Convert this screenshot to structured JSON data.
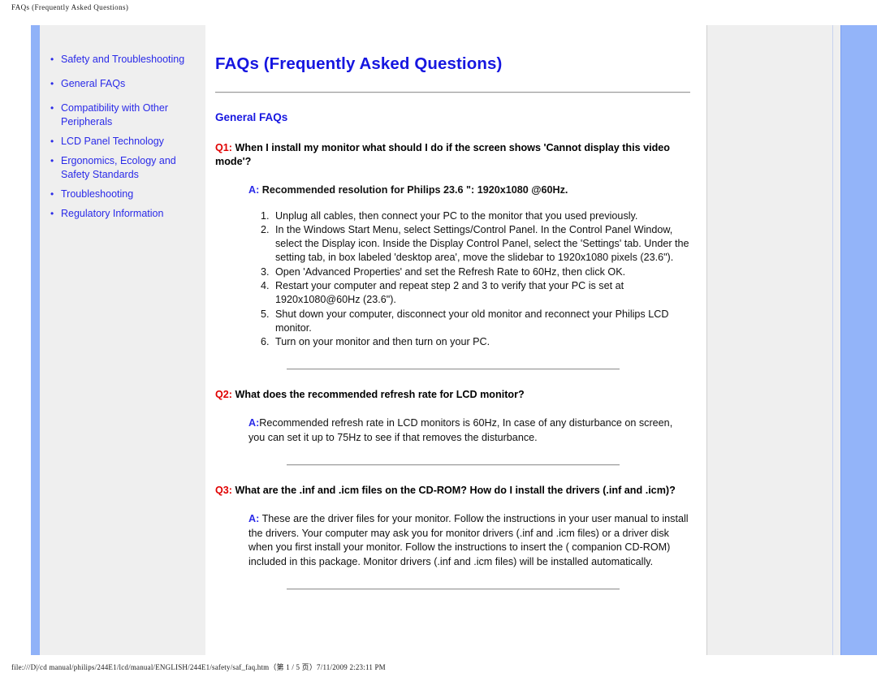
{
  "print_header": "FAQs (Frequently Asked Questions)",
  "print_footer": "file:///D|/cd manual/philips/244E1/lcd/manual/ENGLISH/244E1/safety/saf_faq.htm（第 1 / 5 页）7/11/2009 2:23:11 PM",
  "colors": {
    "link_blue": "#2a2ae8",
    "heading_blue": "#1616e0",
    "question_red": "#e00000",
    "answer_blue": "#2a2ae8",
    "accent_bar": "#90b2f8",
    "panel_gray": "#efefef"
  },
  "sidebar": {
    "items": [
      {
        "label": "Safety and Troubleshooting"
      },
      {
        "label": "General FAQs"
      },
      {
        "label": "Compatibility with Other Peripherals"
      },
      {
        "label": "LCD Panel Technology"
      },
      {
        "label": "Ergonomics, Ecology and Safety Standards"
      },
      {
        "label": "Troubleshooting"
      },
      {
        "label": "Regulatory Information"
      }
    ]
  },
  "main": {
    "title": "FAQs (Frequently Asked Questions)",
    "section_title": "General FAQs",
    "faqs": [
      {
        "q_marker": "Q1:",
        "question": "When I install my monitor what should I do if the screen shows 'Cannot display this video mode'?",
        "a_marker": "A:",
        "answer": "Recommended resolution for Philips 23.6 \": 1920x1080 @60Hz.",
        "steps": [
          "Unplug all cables, then connect your PC to the monitor that you used previously.",
          "In the Windows Start Menu, select Settings/Control Panel. In the Control Panel Window, select the Display icon. Inside the Display Control Panel, select the 'Settings' tab. Under the setting tab, in box labeled 'desktop area', move the slidebar to 1920x1080 pixels (23.6\").",
          "Open 'Advanced Properties' and set the Refresh Rate to 60Hz, then click OK.",
          "Restart your computer and repeat step 2 and 3 to verify that your PC is set at 1920x1080@60Hz (23.6\").",
          "Shut down your computer, disconnect your old monitor and reconnect your Philips LCD monitor.",
          "Turn on your monitor and then turn on your PC."
        ]
      },
      {
        "q_marker": "Q2:",
        "question": "What does the recommended refresh rate for LCD monitor?",
        "a_marker": "A:",
        "answer": "Recommended refresh rate in LCD monitors is 60Hz, In case of any disturbance on screen, you can set it up to 75Hz to see if that removes the disturbance.",
        "steps": []
      },
      {
        "q_marker": "Q3:",
        "question": "What are the .inf and .icm files on the CD-ROM? How do I install the drivers (.inf and .icm)?",
        "a_marker": "A:",
        "answer": "These are the driver files for your monitor. Follow the instructions in your user manual to install the drivers. Your computer may ask you for monitor drivers (.inf and .icm files) or a driver disk when you first install your monitor. Follow the instructions to insert the ( companion CD-ROM) included in this package. Monitor drivers (.inf and .icm files) will be installed automatically.",
        "steps": []
      }
    ]
  }
}
